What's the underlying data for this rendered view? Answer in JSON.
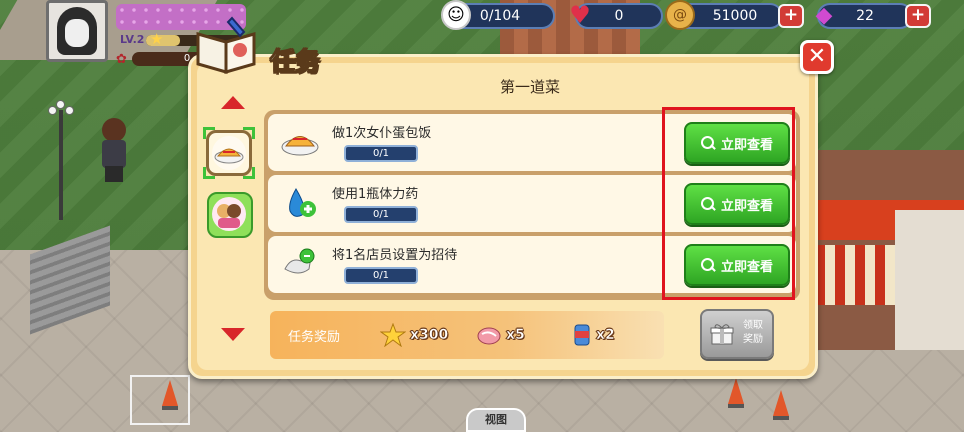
{
  "hud": {
    "player": {
      "level": "LV.2",
      "level_progress": 0.35,
      "roses": "0"
    },
    "resources": [
      {
        "id": "customers",
        "icon": "smiley-face-icon",
        "value": "0/104"
      },
      {
        "id": "hearts",
        "icon": "heart-icon",
        "value": "0"
      },
      {
        "id": "coins",
        "icon": "coin-icon",
        "value": "51000",
        "plus": "+"
      },
      {
        "id": "gems",
        "icon": "gem-icon",
        "value": "22",
        "plus": "+"
      }
    ]
  },
  "dialog": {
    "title": "任务",
    "close_label": "✕",
    "section_title": "第一道菜",
    "tasks": [
      {
        "label": "做1次女仆蛋包饭",
        "progress": "0/1",
        "icon": "omelette-rice-icon",
        "button": "立即查看"
      },
      {
        "label": "使用1瓶体力药",
        "progress": "0/1",
        "icon": "stamina-potion-icon",
        "button": "立即查看"
      },
      {
        "label": "将1名店员设置为招待",
        "progress": "0/1",
        "icon": "staff-assign-icon",
        "button": "立即查看"
      }
    ],
    "reward": {
      "label": "任务奖励",
      "items": [
        {
          "icon": "star-icon",
          "qty": "x300"
        },
        {
          "icon": "meat-icon",
          "qty": "x5"
        },
        {
          "icon": "can-icon",
          "qty": "x2"
        }
      ]
    },
    "claim_button": {
      "line1": "领取",
      "line2": "奖励"
    }
  },
  "bottom": {
    "map_button": "视图"
  },
  "colors": {
    "go_button": "#3cc12e",
    "highlight": "#e0141e",
    "close": "#e03a2e"
  }
}
